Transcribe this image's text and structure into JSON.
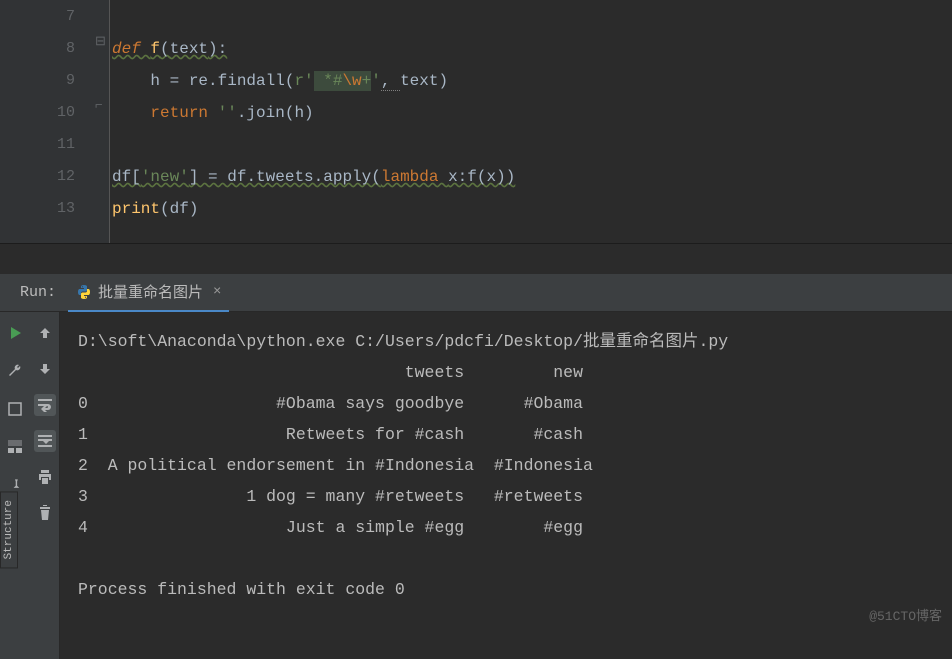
{
  "editor": {
    "lines": [
      {
        "n": "7",
        "code": ""
      },
      {
        "n": "8",
        "code": "def f(text):"
      },
      {
        "n": "9",
        "code": "    h = re.findall(r' *#\\w+', text)"
      },
      {
        "n": "10",
        "code": "    return ''.join(h)"
      },
      {
        "n": "11",
        "code": ""
      },
      {
        "n": "12",
        "code": "df['new'] = df.tweets.apply(lambda x:f(x))"
      },
      {
        "n": "13",
        "code": "print(df)"
      }
    ]
  },
  "run": {
    "label": "Run:",
    "tab_title": "批量重命名图片",
    "console": {
      "cmd": "D:\\soft\\Anaconda\\python.exe C:/Users/pdcfi/Desktop/批量重命名图片.py",
      "header": "                                 tweets         new",
      "rows": [
        "0                   #Obama says goodbye      #Obama",
        "1                    Retweets for #cash       #cash",
        "2  A political endorsement in #Indonesia  #Indonesia",
        "3                1 dog = many #retweets   #retweets",
        "4                    Just a simple #egg        #egg"
      ],
      "exit": "Process finished with exit code 0"
    }
  },
  "side": "Structure",
  "watermark": "@51CTO博客"
}
